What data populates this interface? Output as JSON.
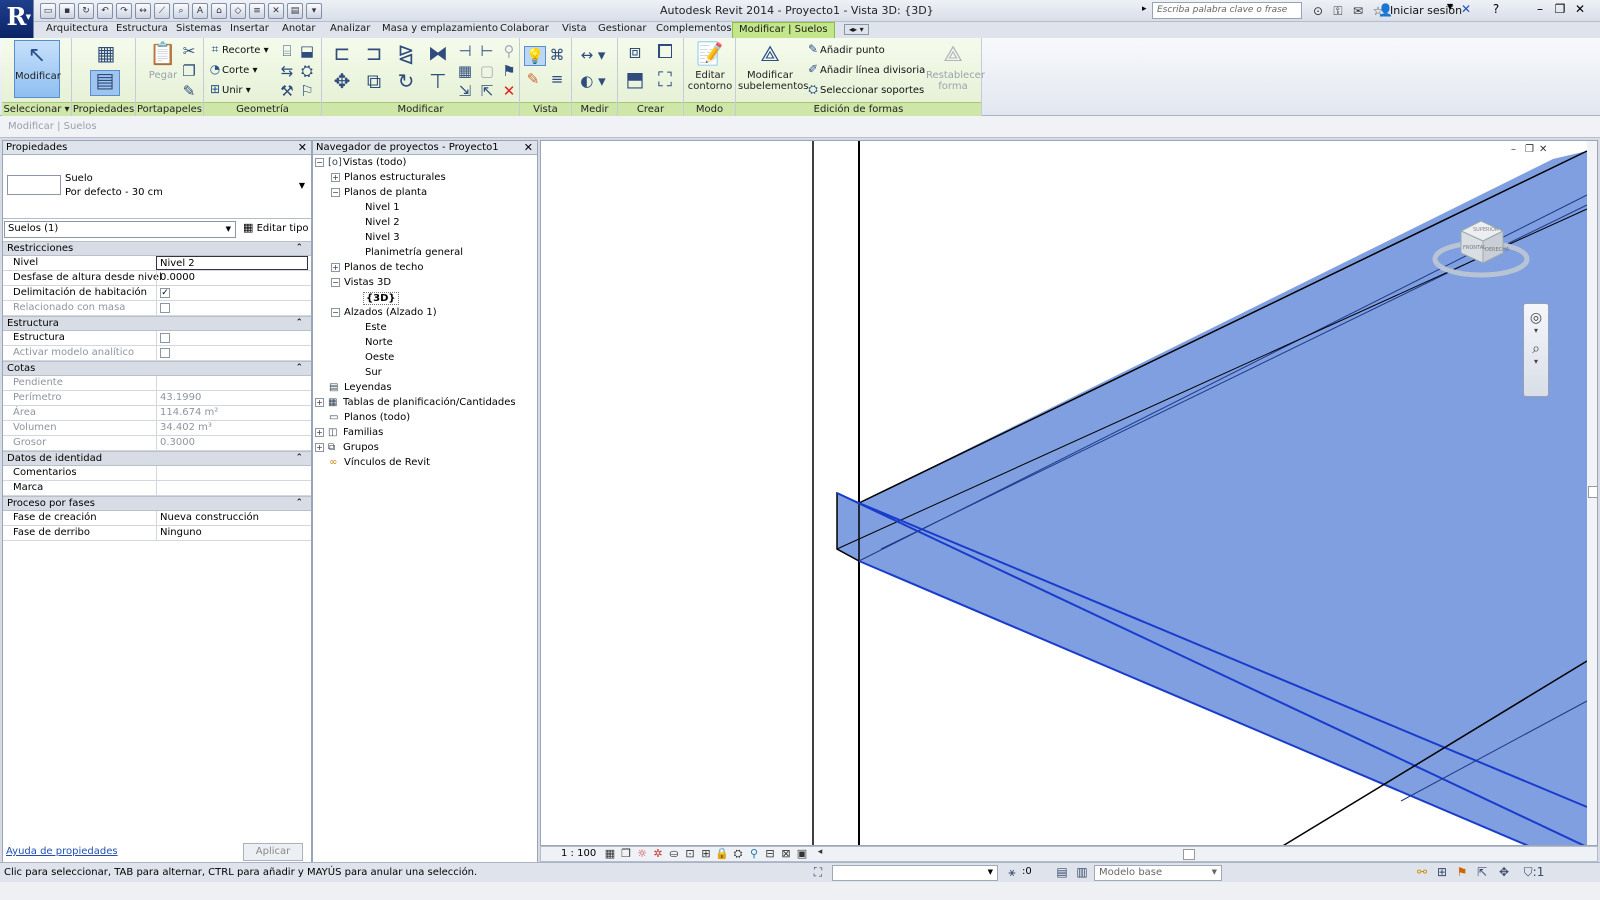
{
  "window": {
    "title": "Autodesk Revit 2014 -     Proyecto1 - Vista 3D: {3D}",
    "search_placeholder": "Escriba palabra clave o frase",
    "signin": "Iniciar sesión",
    "app_letter": "R"
  },
  "tabs": [
    "Arquitectura",
    "Estructura",
    "Sistemas",
    "Insertar",
    "Anotar",
    "Analizar",
    "Masa y emplazamiento",
    "Colaborar",
    "Vista",
    "Gestionar",
    "Complementos",
    "Modificar | Suelos"
  ],
  "ribbon": {
    "modify_label": "Modificar",
    "paste_label": "Pegar",
    "cope_label": "Recorte",
    "cut_label": "Corte",
    "join_label": "Unir",
    "edit_boundary": [
      "Editar",
      "contorno"
    ],
    "modify_sub": [
      "Modificar",
      "subelementos"
    ],
    "add_point": "Añadir punto",
    "add_split_line": "Añadir línea divisoria",
    "pick_supports": "Seleccionar soportes",
    "reset_shape": [
      "Restablecer",
      "forma"
    ],
    "panels": {
      "select": "Seleccionar",
      "properties": "Propiedades",
      "clipboard": "Portapapeles",
      "geometry": "Geometría",
      "modify": "Modificar",
      "view": "Vista",
      "measure": "Medir",
      "create": "Crear",
      "mode": "Modo",
      "shape_editing": "Edición de formas"
    }
  },
  "context_bar": "Modificar | Suelos",
  "properties": {
    "title": "Propiedades",
    "type_name": "Suelo",
    "type_sub": "Por defecto - 30 cm",
    "filter": "Suelos (1)",
    "edit_type": "Editar tipo",
    "groups": {
      "constraints": "Restricciones",
      "structure": "Estructura",
      "dimensions": "Cotas",
      "identity": "Datos de identidad",
      "phasing": "Proceso por fases"
    },
    "rows": {
      "level": {
        "name": "Nivel",
        "value": "Nivel 2"
      },
      "height_offset": {
        "name": "Desfase de altura desde nivel",
        "value": "0.0000"
      },
      "room_bounding": {
        "name": "Delimitación de habitación",
        "value": "✓"
      },
      "related_mass": {
        "name": "Relacionado con masa",
        "value": ""
      },
      "structural": {
        "name": "Estructura",
        "value": ""
      },
      "analytical": {
        "name": "Activar modelo analítico",
        "value": ""
      },
      "slope": {
        "name": "Pendiente",
        "value": ""
      },
      "perimeter": {
        "name": "Perímetro",
        "value": "43.1990"
      },
      "area": {
        "name": "Área",
        "value": "114.674 m²"
      },
      "volume": {
        "name": "Volumen",
        "value": "34.402 m³"
      },
      "thickness": {
        "name": "Grosor",
        "value": "0.3000"
      },
      "comments": {
        "name": "Comentarios",
        "value": ""
      },
      "mark": {
        "name": "Marca",
        "value": ""
      },
      "phase_created": {
        "name": "Fase de creación",
        "value": "Nueva construcción"
      },
      "phase_demolished": {
        "name": "Fase de derribo",
        "value": "Ninguno"
      }
    },
    "help": "Ayuda de propiedades",
    "apply": "Aplicar"
  },
  "browser": {
    "title": "Navegador de proyectos - Proyecto1",
    "nodes": {
      "views": "Vistas (todo)",
      "structural_plans": "Planos estructurales",
      "floor_plans": "Planos de planta",
      "level1": "Nivel 1",
      "level2": "Nivel 2",
      "level3": "Nivel 3",
      "site": "Planimetría general",
      "ceiling_plans": "Planos de techo",
      "views3d": "Vistas 3D",
      "view3d": "{3D}",
      "elevations": "Alzados (Alzado 1)",
      "east": "Este",
      "north": "Norte",
      "west": "Oeste",
      "south": "Sur",
      "legends": "Leyendas",
      "schedules": "Tablas de planificación/Cantidades",
      "sheets": "Planos (todo)",
      "families": "Familias",
      "groups": "Grupos",
      "links": "Vínculos de Revit"
    }
  },
  "viewcube": {
    "front": "FRONTAL",
    "right": "DERECHA",
    "top": "SUPERIOR"
  },
  "viewbar": {
    "scale": "1 : 100"
  },
  "status": {
    "text": "Clic para seleccionar, TAB para alternar, CTRL para añadir y MAYÚS para anular una selección.",
    "zero": ":0",
    "model": "Modelo base"
  },
  "colors": {
    "slab_fill": "#7f9fe0",
    "slab_edge": "#1a3ccc",
    "ribbon_green": "#cfe6a9"
  }
}
